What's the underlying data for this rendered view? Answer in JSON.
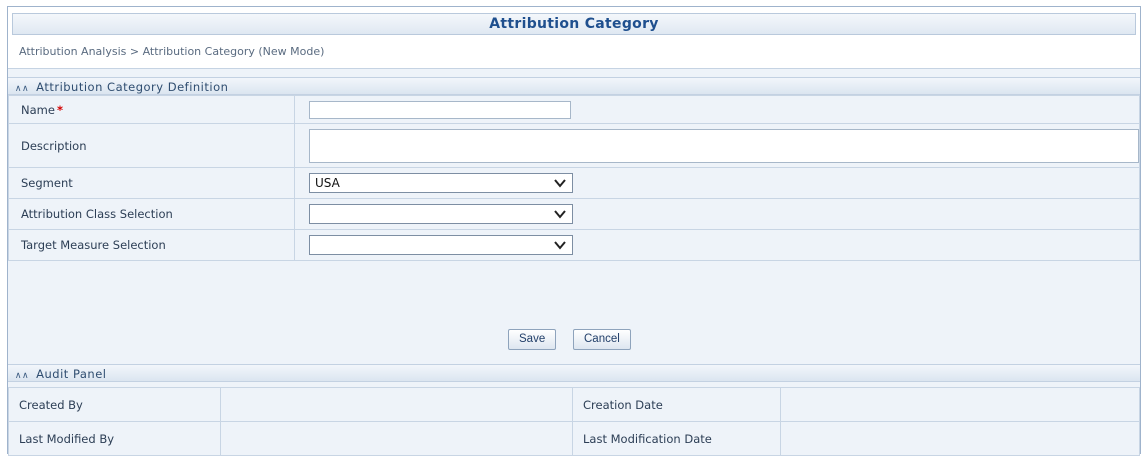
{
  "page": {
    "title": "Attribution Category",
    "breadcrumb": "Attribution Analysis > Attribution Category (New Mode)"
  },
  "definition": {
    "header": "Attribution Category Definition",
    "fields": {
      "name": {
        "label": "Name",
        "required_mark": "*",
        "value": ""
      },
      "description": {
        "label": "Description",
        "value": ""
      },
      "segment": {
        "label": "Segment",
        "selected": "USA"
      },
      "attribution_class": {
        "label": "Attribution Class Selection",
        "selected": ""
      },
      "target_measure": {
        "label": "Target Measure Selection",
        "selected": ""
      }
    }
  },
  "actions": {
    "save_label": "Save",
    "cancel_label": "Cancel"
  },
  "audit": {
    "header": "Audit Panel",
    "created_by_label": "Created By",
    "created_by_value": "",
    "creation_date_label": "Creation Date",
    "creation_date_value": "",
    "last_modified_by_label": "Last Modified By",
    "last_modified_by_value": "",
    "last_modification_date_label": "Last Modification Date",
    "last_modification_date_value": ""
  },
  "icons": {
    "collapse": "double-chevron-up-icon",
    "dropdown": "chevron-down-icon"
  },
  "colors": {
    "title_text": "#1f4f8e",
    "required": "#d40000",
    "panel_bg": "#eef3f9"
  }
}
